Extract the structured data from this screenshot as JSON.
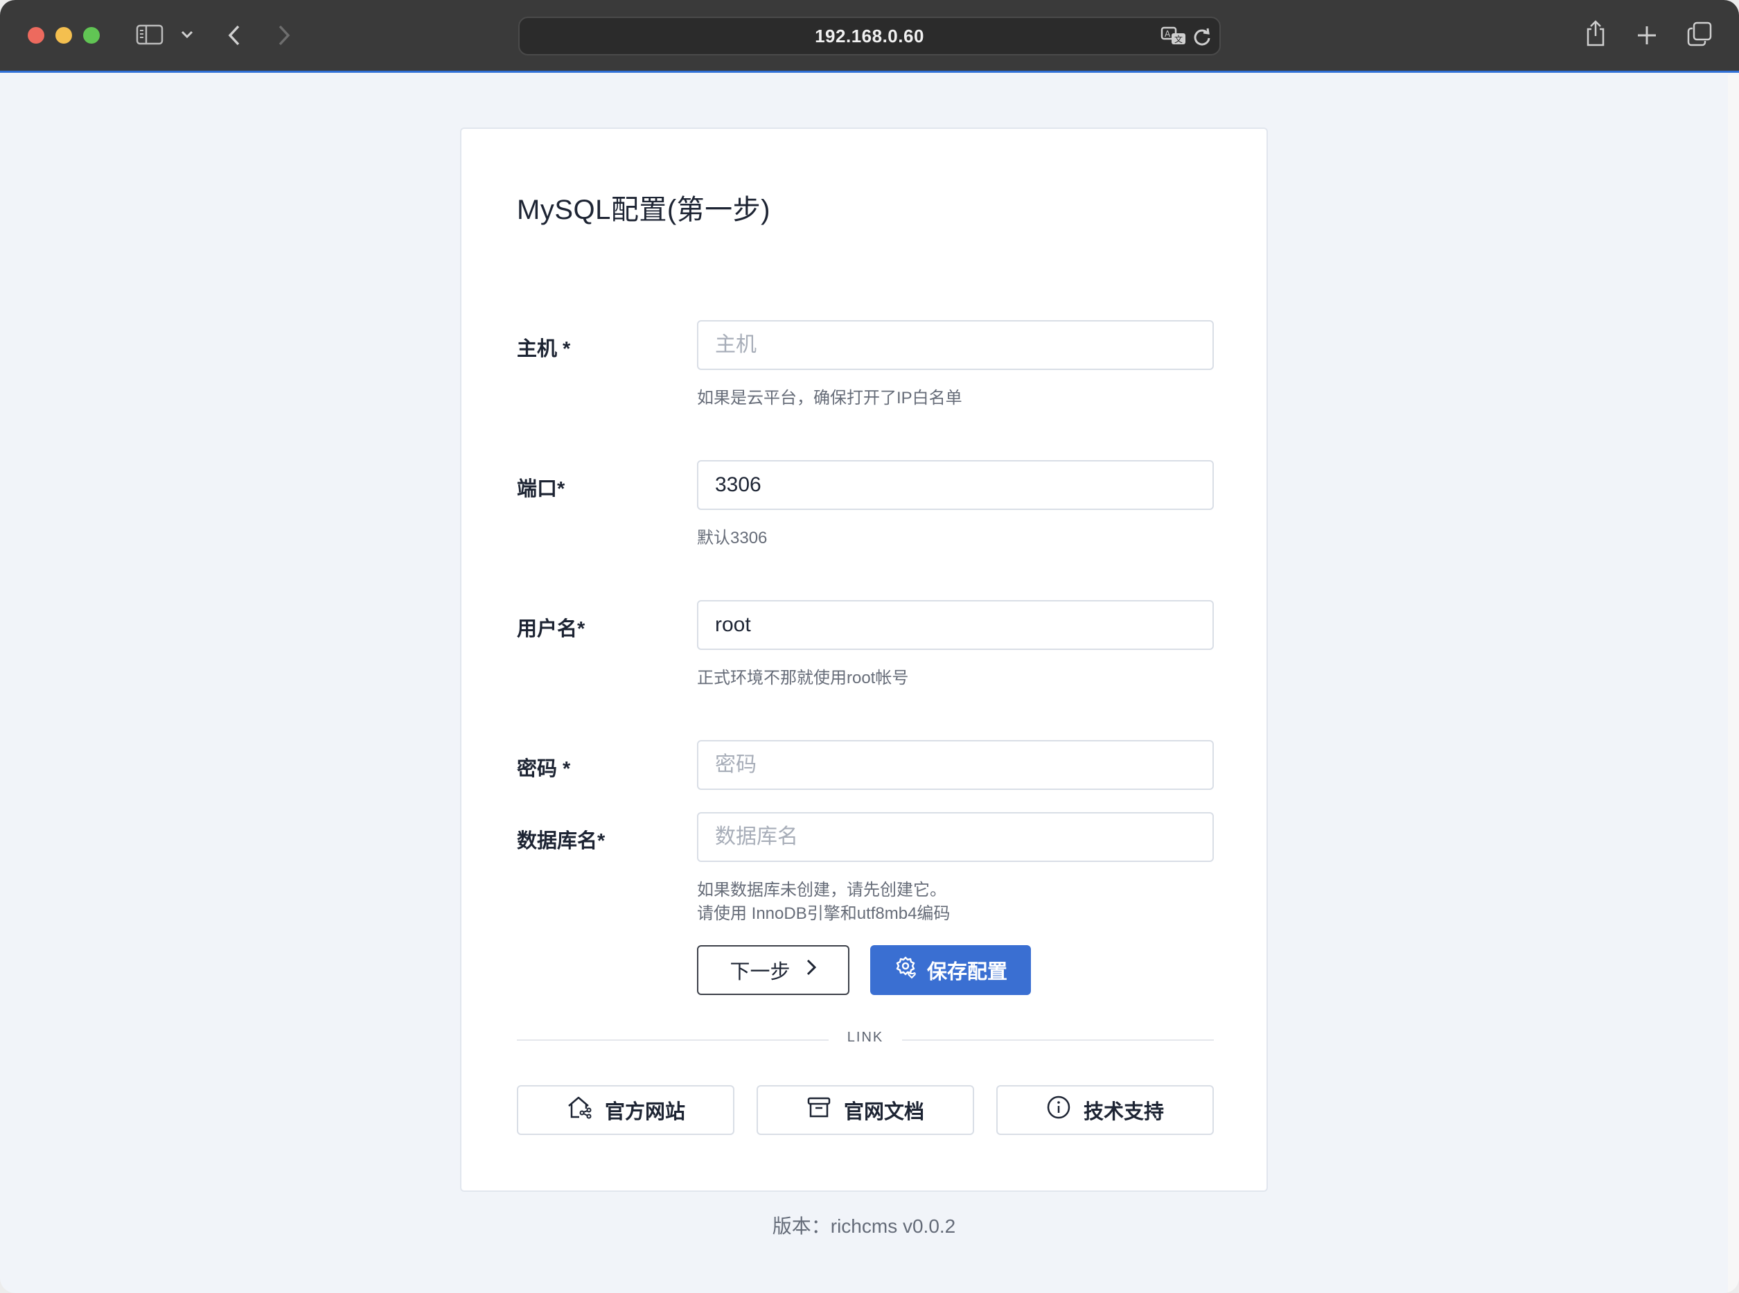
{
  "browser": {
    "url": "192.168.0.60"
  },
  "form": {
    "title": "MySQL配置(第一步)",
    "host": {
      "label": "主机 *",
      "value": "",
      "placeholder": "主机",
      "help": "如果是云平台，确保打开了IP白名单"
    },
    "port": {
      "label": "端口*",
      "value": "3306",
      "placeholder": "",
      "help": "默认3306"
    },
    "username": {
      "label": "用户名*",
      "value": "root",
      "placeholder": "",
      "help": "正式环境不那就使用root帐号"
    },
    "password": {
      "label": "密码 *",
      "value": "",
      "placeholder": "密码"
    },
    "database": {
      "label": "数据库名*",
      "value": "",
      "placeholder": "数据库名",
      "help_line1": "如果数据库未创建，请先创建它。",
      "help_line2": "请使用 InnoDB引擎和utf8mb4编码"
    },
    "next_label": "下一步",
    "save_label": "保存配置"
  },
  "links": {
    "divider": "LINK",
    "items": [
      {
        "label": "官方网站",
        "icon": "home-icon"
      },
      {
        "label": "官网文档",
        "icon": "archive-icon"
      },
      {
        "label": "技术支持",
        "icon": "info-icon"
      }
    ]
  },
  "footer": {
    "version": "版本：richcms v0.0.2"
  },
  "colors": {
    "primary": "#3a6fd2",
    "page_bg": "#f1f4f9",
    "toolbar_bg": "#3a3a3a"
  }
}
